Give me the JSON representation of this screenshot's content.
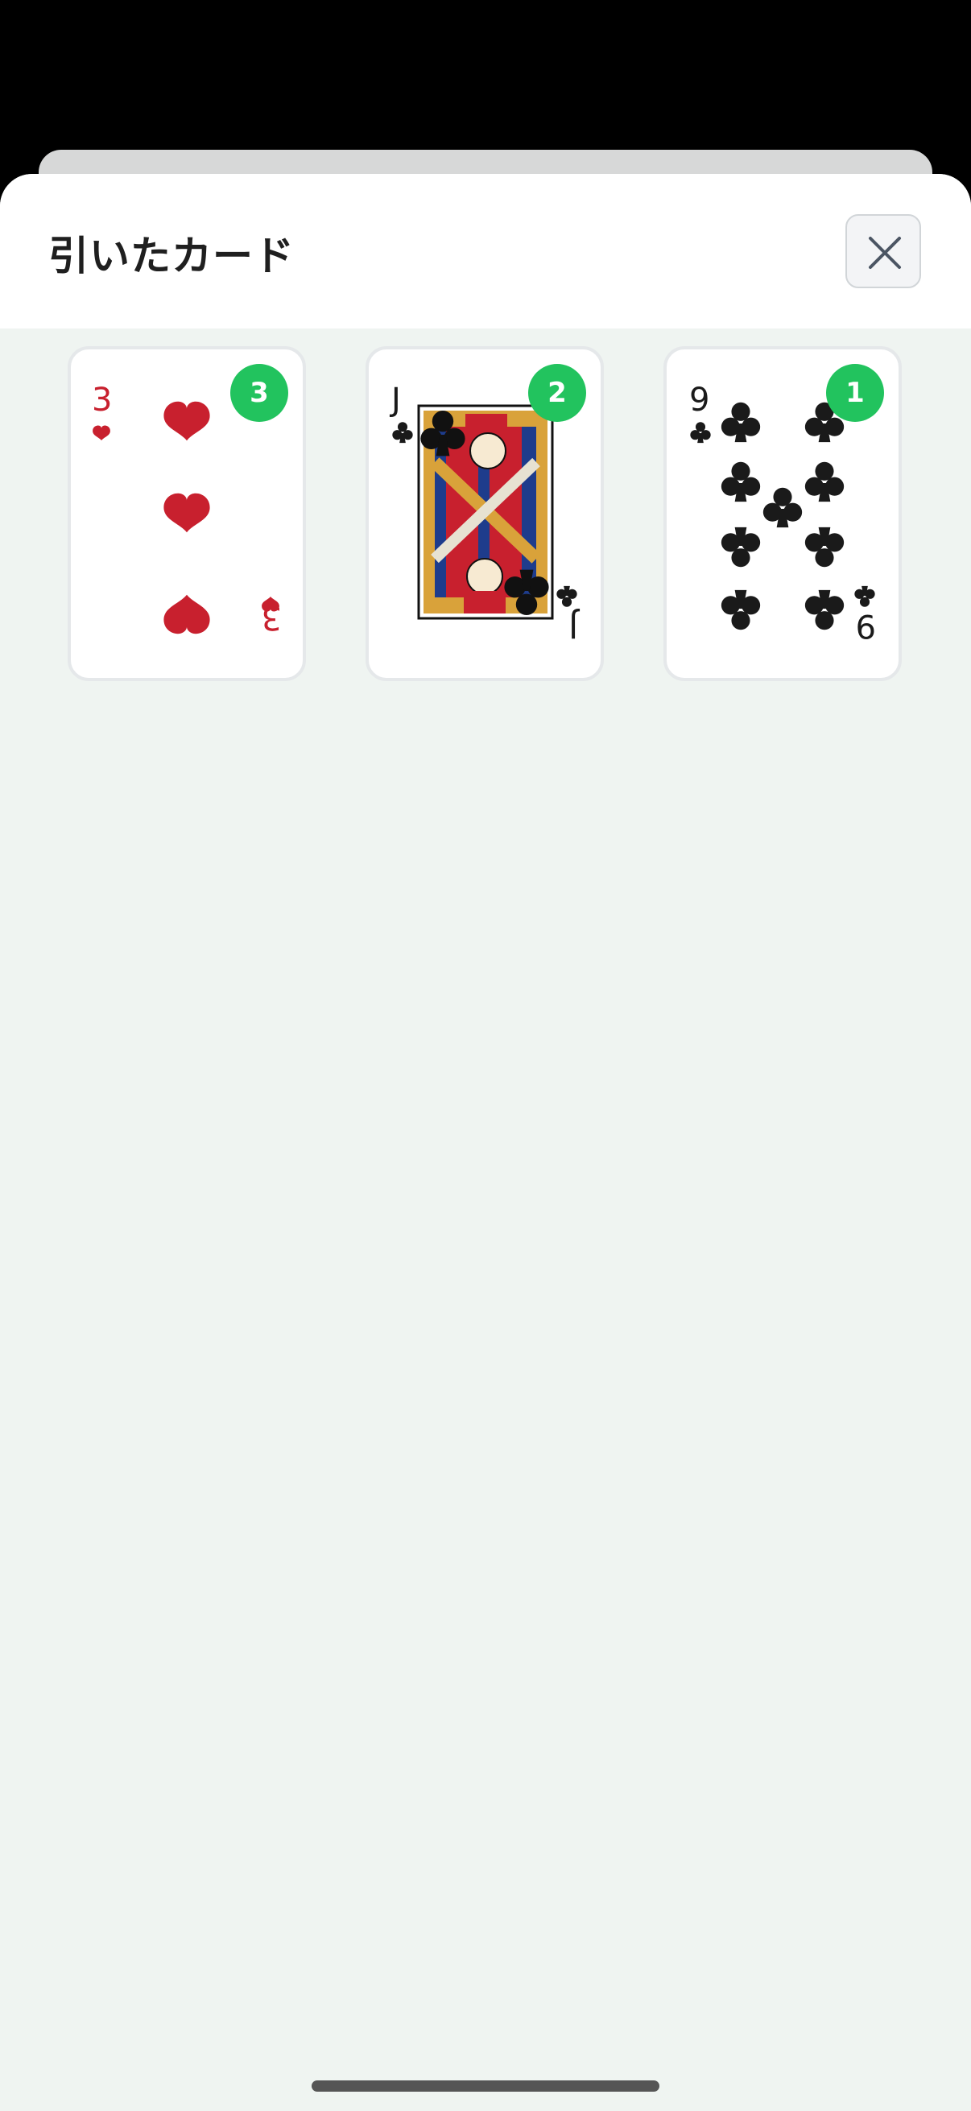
{
  "sheet": {
    "title": "引いたカード",
    "close_icon": "close-icon"
  },
  "cards": [
    {
      "rank": "3",
      "suit": "hearts",
      "order_badge": "3",
      "color": "#c8202e"
    },
    {
      "rank": "J",
      "suit": "clubs",
      "order_badge": "2",
      "color": "#1a1a1a"
    },
    {
      "rank": "9",
      "suit": "clubs",
      "order_badge": "1",
      "color": "#1a1a1a"
    }
  ],
  "colors": {
    "sheet_background": "#eff4f1",
    "badge": "#22c35e",
    "heart_red": "#c8202e",
    "club_black": "#1a1a1a"
  }
}
